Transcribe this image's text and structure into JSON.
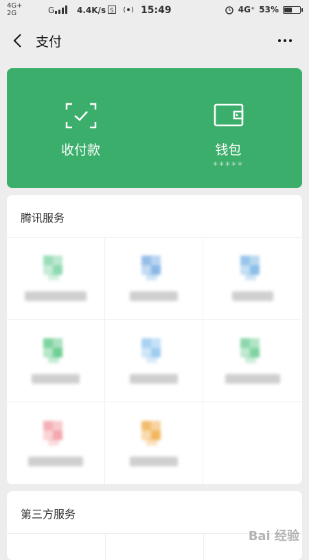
{
  "status_bar": {
    "net_top": "4G+",
    "net_bottom": "2G",
    "carrier": "G",
    "speed": "4.4K/s",
    "time": "15:49",
    "net_right": "4G⁺",
    "battery": "53%",
    "battery_level": 0.53
  },
  "nav": {
    "title": "支付"
  },
  "green_card": {
    "pay_label": "收付款",
    "wallet_label": "钱包",
    "wallet_balance": "*****",
    "color": "#3cae6b"
  },
  "tencent_services": {
    "title": "腾讯服务",
    "items": [
      {
        "label": "",
        "icon": "tile-icon",
        "color": "#8fd9b0"
      },
      {
        "label": "",
        "icon": "tile-icon",
        "color": "#8ab8e6"
      },
      {
        "label": "",
        "icon": "tile-icon",
        "color": "#8cbfe8"
      },
      {
        "label": "",
        "icon": "tile-icon",
        "color": "#6fcf94"
      },
      {
        "label": "",
        "icon": "tile-icon",
        "color": "#9fcdf0"
      },
      {
        "label": "",
        "icon": "tile-icon",
        "color": "#7fd3a2"
      },
      {
        "label": "",
        "icon": "tile-icon",
        "color": "#f3a7ae"
      },
      {
        "label": "",
        "icon": "tile-icon",
        "color": "#f2b65f"
      }
    ]
  },
  "third_party": {
    "title": "第三方服务"
  },
  "watermark": "Bai 经验"
}
